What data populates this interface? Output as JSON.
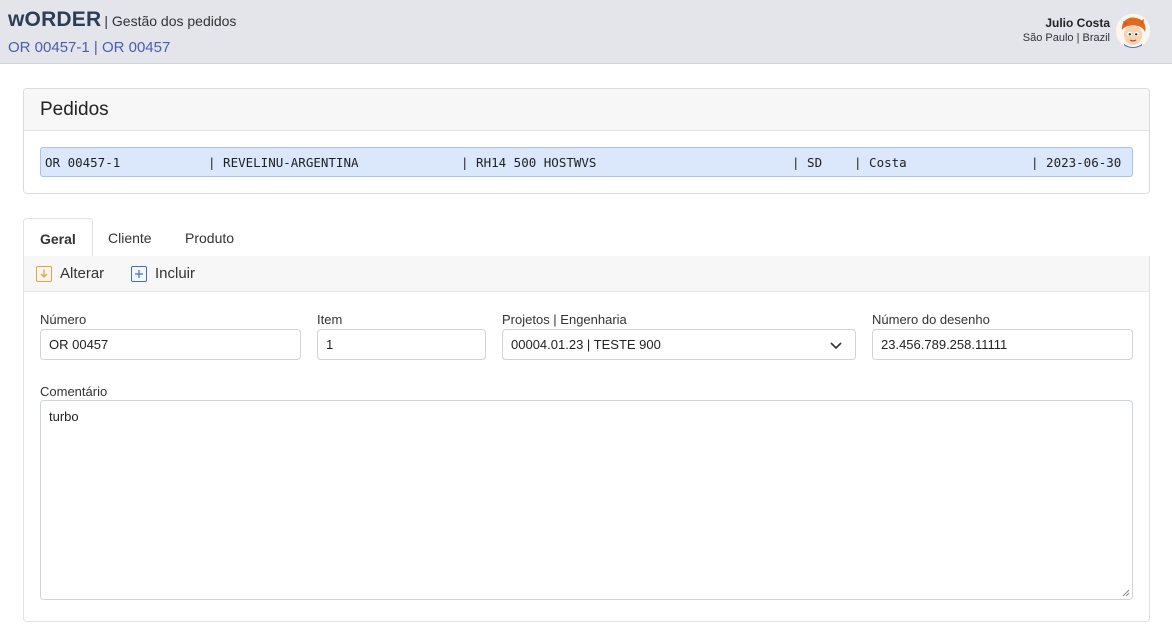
{
  "header": {
    "brand": "wORDER",
    "subtitle": "| Gestão dos pedidos",
    "order_ref": "OR 00457-1 | OR 00457",
    "user_name": "Julio Costa",
    "user_location": "São Paulo | Brazil"
  },
  "orders_card": {
    "title": "Pedidos",
    "selected_row": {
      "order": "OR 00457-1",
      "customer": "| REVELINU-ARGENTINA",
      "product": "| RH14 500 HOSTWVS",
      "code": "| SD",
      "user": "| Costa",
      "date": "| 2023-06-30"
    }
  },
  "tabs": [
    {
      "label": "Geral",
      "active": true
    },
    {
      "label": "Cliente",
      "active": false
    },
    {
      "label": "Produto",
      "active": false
    }
  ],
  "toolbar": {
    "edit_label": "Alterar",
    "edit_icon": "download-edit-icon",
    "add_label": "Incluir",
    "add_icon": "plus-square-icon"
  },
  "form": {
    "numero_label": "Número",
    "numero_value": "OR 00457",
    "item_label": "Item",
    "item_value": "1",
    "projetos_label": "Projetos | Engenharia",
    "projetos_value": "00004.01.23 | TESTE 900",
    "desenho_label": "Número do desenho",
    "desenho_value": "23.456.789.258.11111",
    "comentario_label": "Comentário",
    "comentario_value": "turbo"
  },
  "colors": {
    "header_bg": "#e4e5ea",
    "brand": "#2c3e57",
    "link": "#4a5db4",
    "selection_bg": "#dbe7fb",
    "icon_orange": "#f0a030",
    "icon_blue": "#3a6fd0"
  }
}
